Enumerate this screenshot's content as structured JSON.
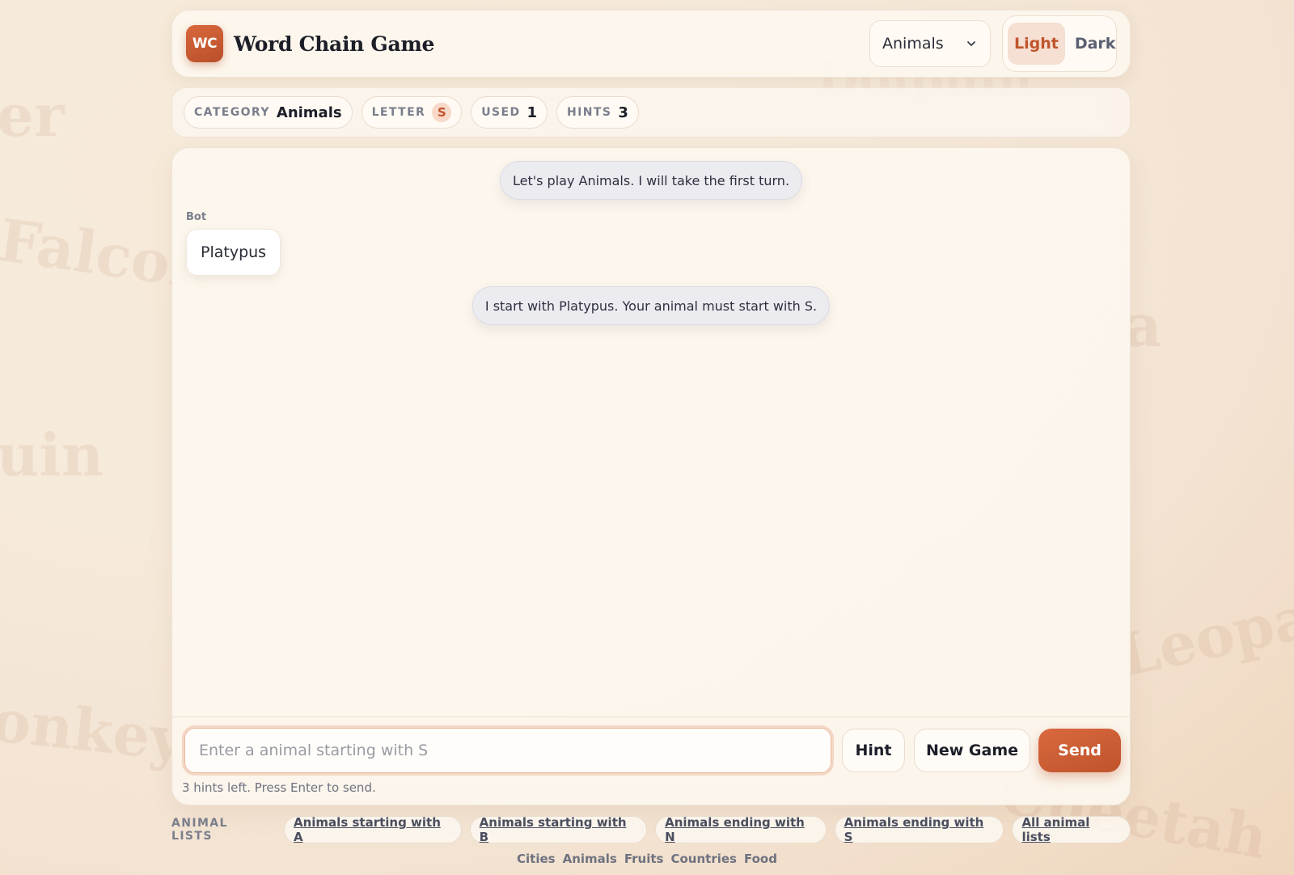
{
  "background_words": [
    "er",
    "Falcon",
    "uin",
    "onkey",
    "Dolphin",
    "a",
    "Leopard",
    "Cheetah"
  ],
  "header": {
    "logo_text": "WC",
    "title": "Word Chain Game",
    "category_select": "Animals",
    "theme_light": "Light",
    "theme_dark": "Dark"
  },
  "stats": {
    "category_label": "CATEGORY",
    "category_value": "Animals",
    "letter_label": "LETTER",
    "letter_value": "S",
    "used_label": "USED",
    "used_value": "1",
    "hints_label": "HINTS",
    "hints_value": "3"
  },
  "chat": {
    "system_1": "Let's play Animals. I will take the first turn.",
    "bot_label": "Bot",
    "bot_message": "Platypus",
    "system_2": "I start with Platypus. Your animal must start with S."
  },
  "composer": {
    "placeholder": "Enter a animal starting with S",
    "hint_button": "Hint",
    "new_game_button": "New Game",
    "send_button": "Send",
    "helper": "3 hints left. Press Enter to send."
  },
  "animal_lists": {
    "label": "ANIMAL LISTS",
    "links": [
      "Animals starting with A",
      "Animals starting with B",
      "Animals ending with N",
      "Animals ending with S",
      "All animal lists"
    ]
  },
  "nav": [
    "Cities",
    "Animals",
    "Fruits",
    "Countries",
    "Food"
  ],
  "colors": {
    "accent": "#c9592f",
    "background": "#f6eadb",
    "panel": "#fcf6ee",
    "system_bubble": "#ecebf0"
  }
}
